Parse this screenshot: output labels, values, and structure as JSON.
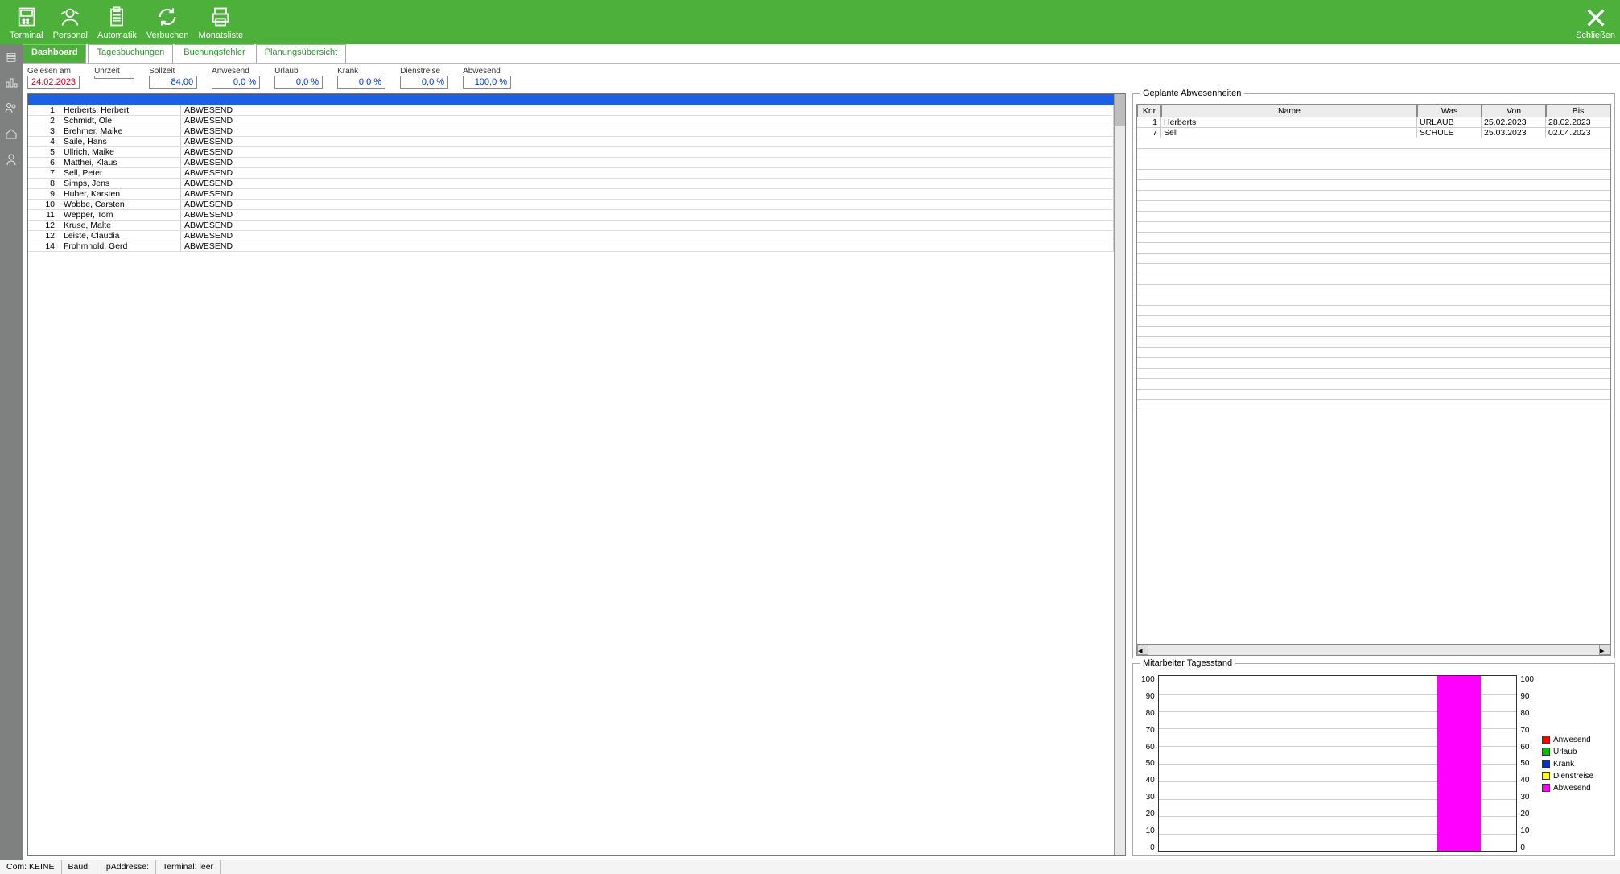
{
  "toolbar": {
    "terminal": "Terminal",
    "personal": "Personal",
    "automatik": "Automatik",
    "verbuchen": "Verbuchen",
    "monatsliste": "Monatsliste",
    "schliessen": "Schließen"
  },
  "tabs": {
    "dashboard": "Dashboard",
    "tagesbuchungen": "Tagesbuchungen",
    "buchungsfehler": "Buchungsfehler",
    "planungsuebersicht": "Planungsübersicht"
  },
  "summary": {
    "gelesen_am_lbl": "Gelesen am",
    "gelesen_am_val": "24.02.2023",
    "uhrzeit_lbl": "Uhrzeit",
    "uhrzeit_val": "",
    "sollzeit_lbl": "Sollzeit",
    "sollzeit_val": "84,00",
    "anwesend_lbl": "Anwesend",
    "anwesend_val": "0,0 %",
    "urlaub_lbl": "Urlaub",
    "urlaub_val": "0,0 %",
    "krank_lbl": "Krank",
    "krank_val": "0,0 %",
    "dienstreise_lbl": "Dienstreise",
    "dienstreise_val": "0,0 %",
    "abwesend_lbl": "Abwesend",
    "abwesend_val": "100,0 %"
  },
  "people": [
    {
      "idx": "1",
      "name": "Herberts, Herbert",
      "status": "ABWESEND"
    },
    {
      "idx": "2",
      "name": "Schmidt, Ole",
      "status": "ABWESEND"
    },
    {
      "idx": "3",
      "name": "Brehmer, Maike",
      "status": "ABWESEND"
    },
    {
      "idx": "4",
      "name": "Saile, Hans",
      "status": "ABWESEND"
    },
    {
      "idx": "5",
      "name": "Ullrich, Maike",
      "status": "ABWESEND"
    },
    {
      "idx": "6",
      "name": "Matthei, Klaus",
      "status": "ABWESEND"
    },
    {
      "idx": "7",
      "name": "Sell, Peter",
      "status": "ABWESEND"
    },
    {
      "idx": "8",
      "name": "Simps, Jens",
      "status": "ABWESEND"
    },
    {
      "idx": "9",
      "name": "Huber, Karsten",
      "status": "ABWESEND"
    },
    {
      "idx": "10",
      "name": "Wobbe, Carsten",
      "status": "ABWESEND"
    },
    {
      "idx": "11",
      "name": "Wepper, Tom",
      "status": "ABWESEND"
    },
    {
      "idx": "12",
      "name": "Kruse, Malte",
      "status": "ABWESEND"
    },
    {
      "idx": "12",
      "name": "Leiste, Claudia",
      "status": "ABWESEND"
    },
    {
      "idx": "14",
      "name": "Frohmhold, Gerd",
      "status": "ABWESEND"
    }
  ],
  "absence_panel": {
    "title": "Geplante Abwesenheiten",
    "cols": {
      "knr": "Knr",
      "name": "Name",
      "was": "Was",
      "von": "Von",
      "bis": "Bis"
    },
    "rows": [
      {
        "knr": "1",
        "name": "Herberts",
        "was": "URLAUB",
        "von": "25.02.2023",
        "bis": "28.02.2023"
      },
      {
        "knr": "7",
        "name": "Sell",
        "was": "SCHULE",
        "von": "25.03.2023",
        "bis": "02.04.2023"
      }
    ]
  },
  "chart_panel": {
    "title": "Mitarbeiter Tagesstand",
    "legend": {
      "anwesend": "Anwesend",
      "urlaub": "Urlaub",
      "krank": "Krank",
      "dienstreise": "Dienstreise",
      "abwesend": "Abwesend"
    },
    "colors": {
      "anwesend": "#ff0000",
      "urlaub": "#00c000",
      "krank": "#0033cc",
      "dienstreise": "#ffff00",
      "abwesend": "#ff00ff"
    }
  },
  "chart_data": {
    "type": "bar",
    "categories": [
      "Anwesend",
      "Urlaub",
      "Krank",
      "Dienstreise",
      "Abwesend"
    ],
    "values": [
      0,
      0,
      0,
      0,
      100
    ],
    "ylabel": "",
    "ylim": [
      0,
      100
    ],
    "ticks": [
      0,
      10,
      20,
      30,
      40,
      50,
      60,
      70,
      80,
      90,
      100
    ]
  },
  "status_bar": {
    "com": "Com: KEINE",
    "baud": "Baud:",
    "ip": "IpAddresse:",
    "terminal": "Terminal: leer"
  }
}
